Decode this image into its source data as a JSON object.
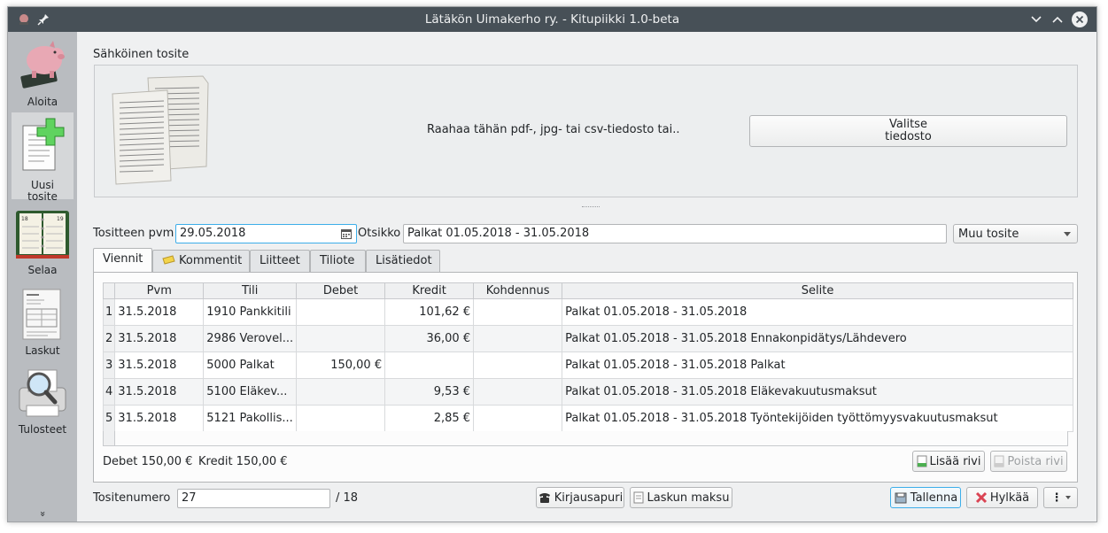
{
  "window": {
    "title": "Lätäkön Uimakerho ry. - Kitupiikki 1.0-beta",
    "minimize_glyph": "⌄",
    "maximize_glyph": "⌃",
    "close_glyph": "✕"
  },
  "sidebar": {
    "items": [
      {
        "label": "Aloita",
        "icon": "piggy-bank-icon"
      },
      {
        "label_line1": "Uusi",
        "label_line2": "tosite",
        "icon": "new-document-icon"
      },
      {
        "label": "Selaa",
        "icon": "ledger-book-icon"
      },
      {
        "label": "Laskut",
        "icon": "invoice-icon"
      },
      {
        "label": "Tulosteet",
        "icon": "print-preview-icon"
      }
    ],
    "more_glyph": "»"
  },
  "attachment": {
    "group_title": "Sähköinen tosite",
    "drop_text": "Raahaa tähän pdf-, jpg- tai csv-tiedosto tai..",
    "choose_button_line1": "Valitse",
    "choose_button_line2": "tiedosto"
  },
  "voucher": {
    "date_label": "Tositteen pvm",
    "date_value": "29.05.2018",
    "title_label": "Otsikko",
    "title_value": "Palkat 01.05.2018 - 31.05.2018",
    "type_value": "Muu tosite"
  },
  "tabs": [
    {
      "label": "Viennit"
    },
    {
      "label": "Kommentit"
    },
    {
      "label": "Liitteet"
    },
    {
      "label": "Tiliote"
    },
    {
      "label": "Lisätiedot"
    }
  ],
  "entries": {
    "columns": [
      "Pvm",
      "Tili",
      "Debet",
      "Kredit",
      "Kohdennus",
      "Selite"
    ],
    "rows": [
      {
        "n": "1",
        "pvm": "31.5.2018",
        "tili": "1910 Pankkitili",
        "debet": "",
        "kredit": "101,62 €",
        "kohdennus": "",
        "selite": "Palkat 01.05.2018 - 31.05.2018"
      },
      {
        "n": "2",
        "pvm": "31.5.2018",
        "tili": "2986 Verovel...",
        "debet": "",
        "kredit": "36,00 €",
        "kohdennus": "",
        "selite": "Palkat 01.05.2018 - 31.05.2018 Ennakonpidätys/Lähdevero"
      },
      {
        "n": "3",
        "pvm": "31.5.2018",
        "tili": "5000 Palkat",
        "debet": "150,00 €",
        "kredit": "",
        "kohdennus": "",
        "selite": "Palkat 01.05.2018 - 31.05.2018 Palkat"
      },
      {
        "n": "4",
        "pvm": "31.5.2018",
        "tili": "5100 Eläkev...",
        "debet": "",
        "kredit": "9,53 €",
        "kohdennus": "",
        "selite": "Palkat 01.05.2018 - 31.05.2018 Eläkevakuutusmaksut"
      },
      {
        "n": "5",
        "pvm": "31.5.2018",
        "tili": "5121 Pakollis...",
        "debet": "",
        "kredit": "2,85 €",
        "kohdennus": "",
        "selite": "Palkat 01.05.2018 - 31.05.2018 Työntekijöiden työttömyysvakuutusmaksut"
      }
    ],
    "totals_debet": "Debet 150,00 €",
    "totals_kredit": "Kredit 150,00 €",
    "add_row_label": "Lisää rivi",
    "remove_row_label": "Poista rivi"
  },
  "footer": {
    "number_label": "Tositenumero",
    "number_value": "27",
    "number_suffix": "/ 18",
    "kirjausapuri_label": "Kirjausapuri",
    "laskun_maksu_label": "Laskun maksu",
    "save_label": "Tallenna",
    "reject_label": "Hylkää",
    "menu_glyph": "⋮"
  },
  "colors": {
    "titlebar": "#475057",
    "sidebar": "#b9bcc0",
    "focus": "#3daee9",
    "reject_red": "#da4453"
  }
}
